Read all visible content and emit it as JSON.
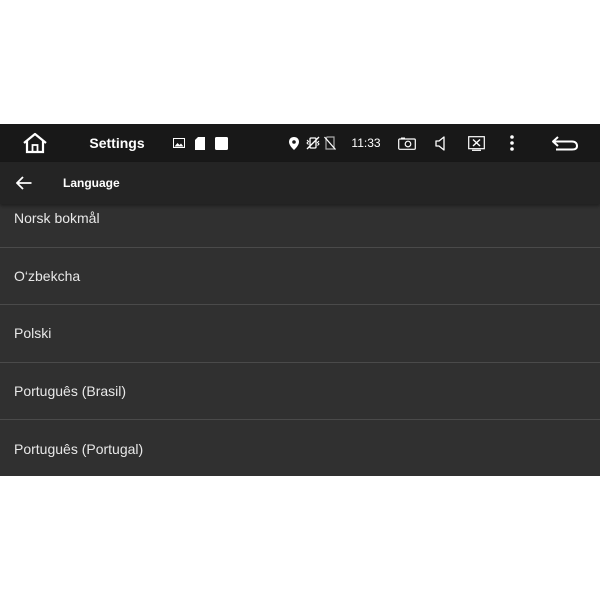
{
  "statusbar": {
    "title": "Settings",
    "time": "11:33",
    "icons": [
      "home-icon",
      "image-notification-icon",
      "sd-card-icon",
      "square-notification-icon",
      "location-icon",
      "vibrate-off-icon",
      "no-sim-icon",
      "camera-icon",
      "volume-icon",
      "close-window-icon",
      "more-vert-icon",
      "return-icon"
    ]
  },
  "appbar": {
    "title": "Language",
    "back_icon": "arrow-back-icon"
  },
  "languages": [
    "Norsk bokmål",
    "O‘zbekcha",
    "Polski",
    "Português (Brasil)",
    "Português (Portugal)"
  ],
  "colors": {
    "statusbar_bg": "#181818",
    "appbar_bg": "#242424",
    "list_bg": "#303030",
    "divider": "#4a4a4a",
    "text": "#e8e8e8"
  }
}
